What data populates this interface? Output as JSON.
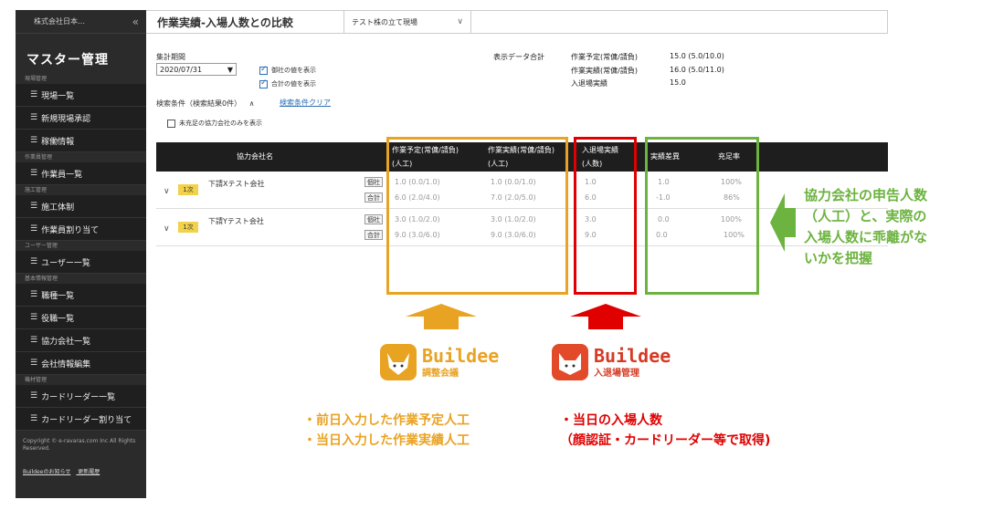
{
  "sidebar": {
    "company": "株式会社日本…",
    "collapse_icon": "«",
    "title": "マスター管理",
    "groups": [
      {
        "section": "現場管理",
        "items": [
          "現場一覧",
          "新規現場承認",
          "稼働情報"
        ]
      },
      {
        "section": "作業員管理",
        "items": [
          "作業員一覧"
        ]
      },
      {
        "section": "施工管理",
        "items": [
          "施工体制",
          "作業員割り当て"
        ]
      },
      {
        "section": "ユーザー管理",
        "items": [
          "ユーザー一覧"
        ]
      },
      {
        "section": "基本情報管理",
        "items": [
          "職種一覧",
          "役職一覧",
          "協力会社一覧",
          "会社情報編集"
        ]
      },
      {
        "section": "機材管理",
        "items": [
          "カードリーダー一覧",
          "カードリーダー割り当て"
        ]
      }
    ],
    "menu_icon": "☰",
    "copyright": "Copyright © e-ravaras.com Inc All Rights Reserved.",
    "link1": "Buildeeのお知らせ",
    "link2": "更新履歴"
  },
  "header": {
    "title": "作業実績-入場人数との比較",
    "site": "テスト株の立て現場",
    "chevron": "∨"
  },
  "filters": {
    "period_label": "集計期間",
    "date": "2020/07/31",
    "date_arrow": "▼",
    "show_company": "御社の値を表示",
    "show_total": "合計の値を表示",
    "search_label": "検索条件（検索結果0件）",
    "search_toggle": "∧",
    "clear_link": "検索条件クリア",
    "unfilled_only": "未充足の協力会社のみを表示"
  },
  "summary": {
    "label": "表示データ合計",
    "rows": [
      {
        "name": "作業予定(常傭/請負)",
        "value": "15.0 (5.0/10.0)"
      },
      {
        "name": "作業実績(常傭/請負)",
        "value": "16.0 (5.0/11.0)"
      },
      {
        "name": "入退場実績",
        "value": "15.0"
      }
    ]
  },
  "table": {
    "col_company": "協力会社名",
    "col_plan": "作業予定(常傭/請負)",
    "col_plan_sub": "(人工)",
    "col_actual": "作業実績(常傭/請負)",
    "col_actual_sub": "(人工)",
    "col_entry": "入退場実績",
    "col_entry_sub": "(人数)",
    "col_diff": "実績差異",
    "col_rate": "充足率",
    "rows": [
      {
        "tier": "1次",
        "name": "下請Xテスト会社",
        "tag1": "個社",
        "tag2": "合計",
        "plan1": "1.0 (0.0/1.0)",
        "plan2": "6.0 (2.0/4.0)",
        "act1": "1.0 (0.0/1.0)",
        "act2": "7.0 (2.0/5.0)",
        "ent1": "1.0",
        "ent2": "6.0",
        "diff1": "1.0",
        "diff2": "-1.0",
        "rate1": "100%",
        "rate2": "86%"
      },
      {
        "tier": "1次",
        "name": "下請Yテスト会社",
        "tag1": "個社",
        "tag2": "合計",
        "plan1": "3.0 (1.0/2.0)",
        "plan2": "9.0 (3.0/6.0)",
        "act1": "3.0 (1.0/2.0)",
        "act2": "9.0 (3.0/6.0)",
        "ent1": "3.0",
        "ent2": "9.0",
        "diff1": "0.0",
        "diff2": "0.0",
        "rate1": "100%",
        "rate2": "100%"
      }
    ]
  },
  "annotations": {
    "green_note": [
      "協力会社の申告人数",
      "（人工）と、実際の",
      "入場人数に乖離がな",
      "いかを把握"
    ],
    "orange_notes": [
      "・前日入力した作業予定人工",
      "・当日入力した作業実績人工"
    ],
    "red_notes": [
      "・当日の入場人数",
      "（顔認証・カードリーダー等で取得)"
    ],
    "logo1_title": "Buildee",
    "logo1_sub": "調整会議",
    "logo2_title": "Buildee",
    "logo2_sub": "入退場管理",
    "colors": {
      "orange": "#e9a323",
      "red": "#e00000",
      "green": "#6cb33f",
      "accent": "#2a6fb3"
    }
  }
}
